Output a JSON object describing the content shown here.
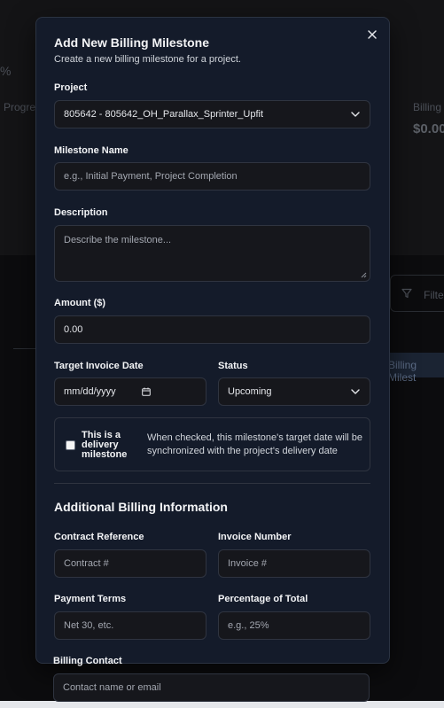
{
  "background": {
    "percent": "%",
    "progress_label": "Progres",
    "billing_label": "Billing",
    "billing_amount": "$0.00",
    "filter_label": "Filte",
    "chip_label": "Billing Milest"
  },
  "modal": {
    "title": "Add New Billing Milestone",
    "subtitle": "Create a new billing milestone for a project.",
    "close_icon": "close-icon",
    "project": {
      "label": "Project",
      "value": "805642 - 805642_OH_Parallax_Sprinter_Upfit"
    },
    "milestone_name": {
      "label": "Milestone Name",
      "placeholder": "e.g., Initial Payment, Project Completion"
    },
    "description": {
      "label": "Description",
      "placeholder": "Describe the milestone..."
    },
    "amount": {
      "label": "Amount ($)",
      "value": "0.00"
    },
    "target_invoice_date": {
      "label": "Target Invoice Date",
      "value": "mm/dd/yyyy"
    },
    "status": {
      "label": "Status",
      "value": "Upcoming"
    },
    "delivery": {
      "checked": false,
      "label": "This is a delivery milestone",
      "help": "When checked, this milestone's target date will be synchronized with the project's delivery date"
    },
    "additional_section_title": "Additional Billing Information",
    "contract_reference": {
      "label": "Contract Reference",
      "placeholder": "Contract #"
    },
    "invoice_number": {
      "label": "Invoice Number",
      "placeholder": "Invoice #"
    },
    "payment_terms": {
      "label": "Payment Terms",
      "placeholder": "Net 30, etc."
    },
    "percentage_of_total": {
      "label": "Percentage of Total",
      "placeholder": "e.g., 25%"
    },
    "billing_contact": {
      "label": "Billing Contact",
      "placeholder": "Contact name or email"
    }
  },
  "colors": {
    "modal_bg": "#141b2a",
    "field_bg": "#16171c",
    "border": "#2f3440"
  }
}
